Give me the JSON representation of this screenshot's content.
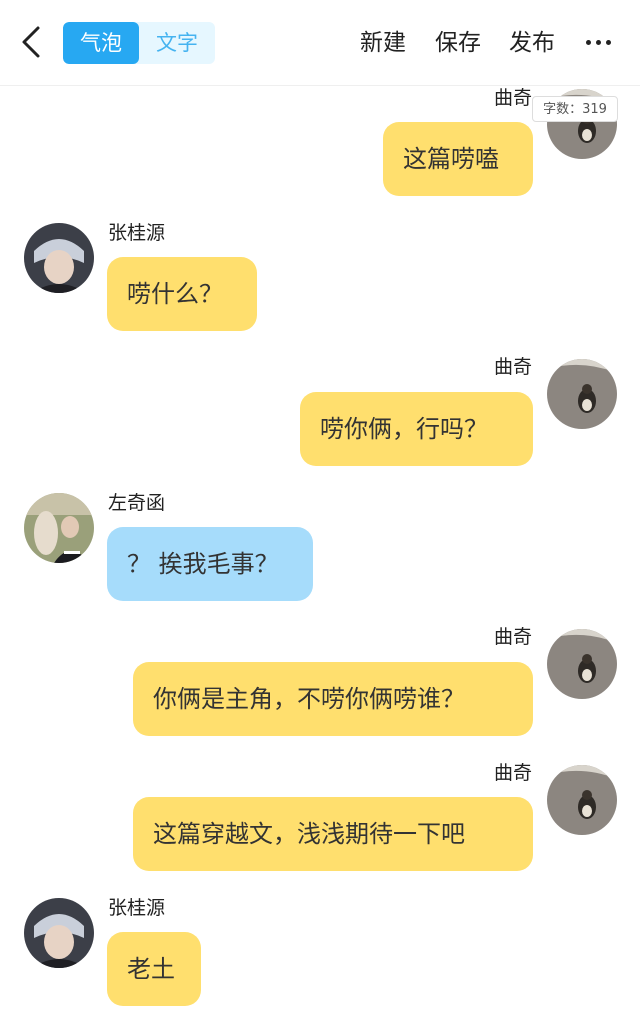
{
  "header": {
    "tabs": [
      {
        "label": "气泡",
        "active": true
      },
      {
        "label": "文字",
        "active": false
      }
    ],
    "actions": {
      "new_label": "新建",
      "save_label": "保存",
      "publish_label": "发布"
    },
    "icons": {
      "back": "chevron-left-icon",
      "more": "more-dots-icon"
    }
  },
  "word_count": {
    "label": "字数",
    "value": "319",
    "text": "字数：319"
  },
  "messages": [
    {
      "sender": "曲奇",
      "side": "right",
      "bubble_color": "yellow",
      "text": "这篇唠嗑"
    },
    {
      "sender": "张桂源",
      "side": "left",
      "bubble_color": "yellow",
      "text": "唠什么？"
    },
    {
      "sender": "曲奇",
      "side": "right",
      "bubble_color": "yellow",
      "text": "唠你俩，行吗？"
    },
    {
      "sender": "左奇函",
      "side": "left",
      "bubble_color": "blue",
      "text": "？ 挨我毛事？"
    },
    {
      "sender": "曲奇",
      "side": "right",
      "bubble_color": "yellow",
      "text": "你俩是主角，不唠你俩唠谁？"
    },
    {
      "sender": "曲奇",
      "side": "right",
      "bubble_color": "yellow",
      "text": "这篇穿越文，浅浅期待一下吧"
    },
    {
      "sender": "张桂源",
      "side": "left",
      "bubble_color": "yellow",
      "text": "老土"
    }
  ],
  "colors": {
    "accent": "#27a8f2",
    "tab_inactive_text": "#45b3f0",
    "bubble_yellow": "#ffdf6e",
    "bubble_blue": "#a6dcfb"
  }
}
